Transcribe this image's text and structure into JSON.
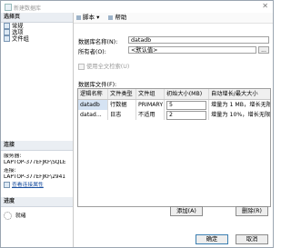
{
  "window": {
    "title": "新建数据库",
    "close_glyph": "✕"
  },
  "sidebar": {
    "header": "选择页",
    "pages": [
      {
        "label": "常规"
      },
      {
        "label": "选项"
      },
      {
        "label": "文件组"
      }
    ]
  },
  "connection": {
    "header": "连接",
    "server_label": "服务器:",
    "server_value": "LAPTOP-377EFJKF\\SQLE",
    "conn_label": "连接:",
    "conn_value": "LAPTOP-377EFJKF\\2941",
    "view_link": "查看连接属性"
  },
  "progress": {
    "header": "进度",
    "status": "就绪"
  },
  "toolbar": {
    "script_label": "脚本",
    "help_label": "帮助"
  },
  "form": {
    "dbname_label": "数据库名称(N):",
    "dbname_value": "datadb",
    "owner_label": "所有者(O):",
    "owner_value": "<默认值>",
    "owner_button": "...",
    "fulltext_label": "使用全文检索(U)",
    "files_label": "数据库文件(F):"
  },
  "files_table": {
    "columns": [
      "逻辑名称",
      "文件类型",
      "文件组",
      "初始大小(MB)",
      "自动增长/最大大小"
    ],
    "rows": [
      [
        "datadb",
        "行数据",
        "PRIMARY",
        "5",
        "增量为 1 MB，增长无限制"
      ],
      [
        "datad...",
        "日志",
        "不适用",
        "2",
        "增量为 10%，增长无限制"
      ]
    ]
  },
  "buttons": {
    "add": "添加(A)",
    "remove": "删除(R)",
    "ok": "确定",
    "cancel": "取消"
  }
}
